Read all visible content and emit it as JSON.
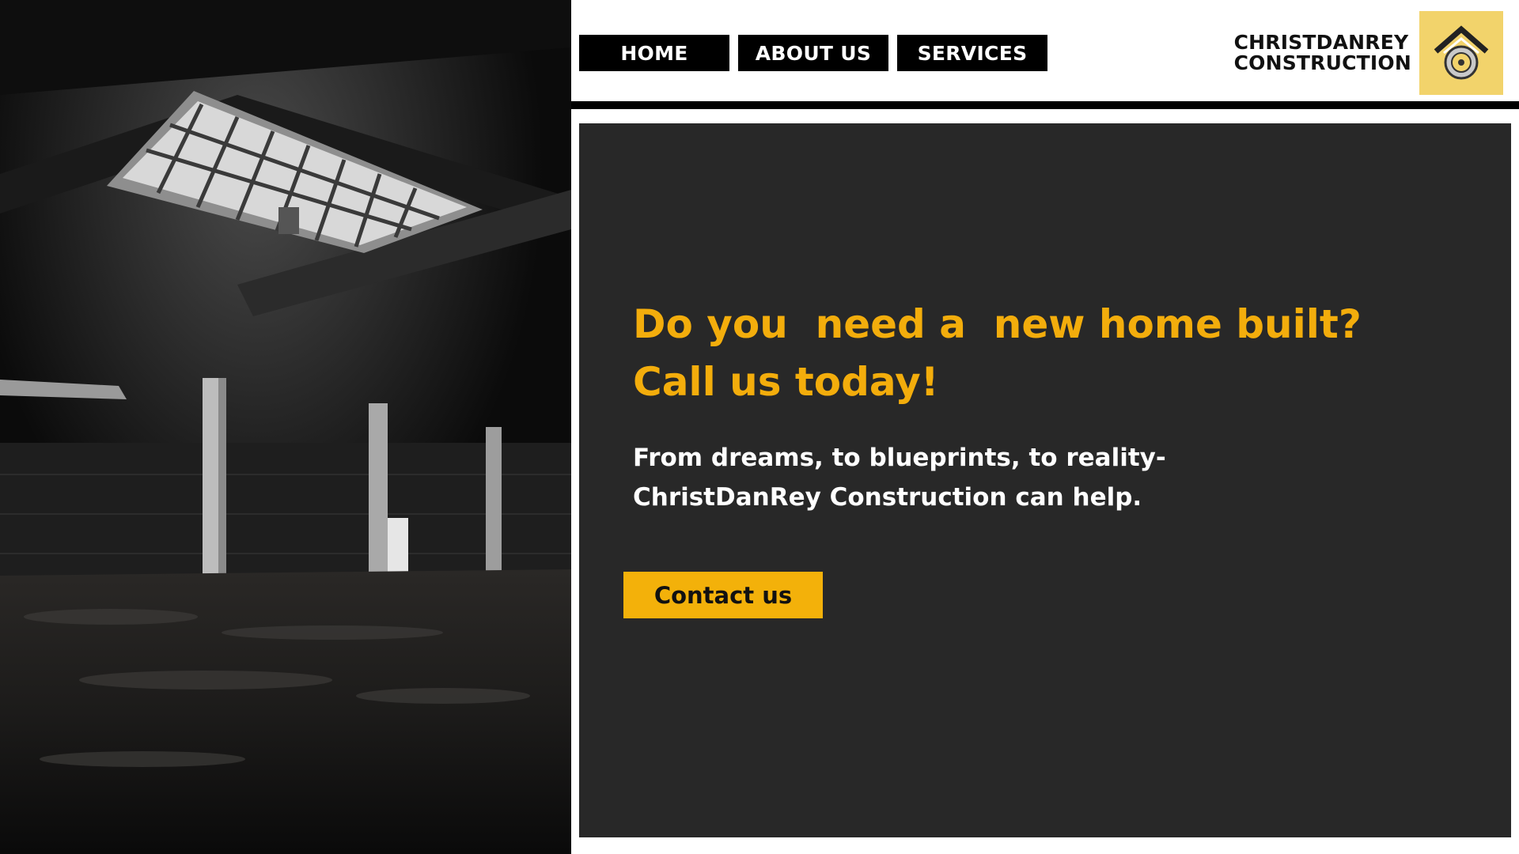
{
  "nav": {
    "items": [
      {
        "label": "HOME"
      },
      {
        "label": "ABOUT US"
      },
      {
        "label": "SERVICES"
      }
    ]
  },
  "brand": {
    "line1": "CHRISTDANREY",
    "line2": "CONSTRUCTION",
    "logo_icon": "house-with-circle-icon",
    "logo_bg": "#f2d36b"
  },
  "hero": {
    "headline": "Do you  need a  new home built?\nCall us today!",
    "subtext_line1": "From dreams, to blueprints, to reality-",
    "subtext_line2": "ChristDanRey Construction can help.",
    "cta_label": "Contact us"
  },
  "colors": {
    "accent": "#f3ad0c",
    "panel": "#282828",
    "nav_bg": "#000000"
  }
}
